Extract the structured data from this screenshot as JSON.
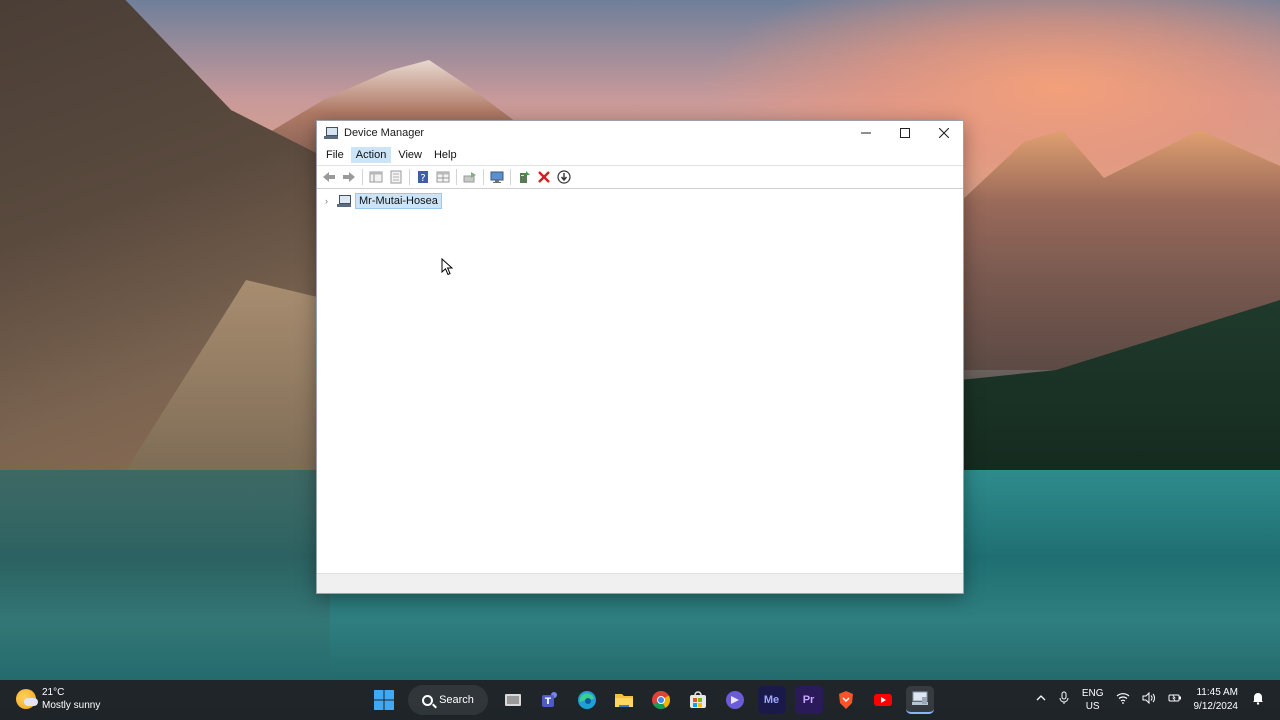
{
  "window": {
    "title": "Device Manager",
    "menu": [
      "File",
      "Action",
      "View",
      "Help"
    ],
    "active_menu_index": 1
  },
  "tree": {
    "root_label": "Mr-Mutai-Hosea"
  },
  "taskbar": {
    "weather_temp": "21°C",
    "weather_desc": "Mostly sunny",
    "search_label": "Search",
    "lang_top": "ENG",
    "lang_bottom": "US",
    "time": "11:45 AM",
    "date": "9/12/2024",
    "icons": [
      "windows-start-icon",
      "task-view-icon",
      "teams-icon",
      "edge-icon",
      "file-explorer-icon",
      "chrome-icon",
      "store-icon",
      "copilot-icon",
      "media-encoder-icon",
      "premiere-icon",
      "brave-icon",
      "youtube-icon",
      "device-manager-taskbar-icon"
    ],
    "media_encoder_label": "Me",
    "premiere_label": "Pr"
  },
  "colors": {
    "selection": "#cce4f7",
    "taskbar": "#202024"
  }
}
